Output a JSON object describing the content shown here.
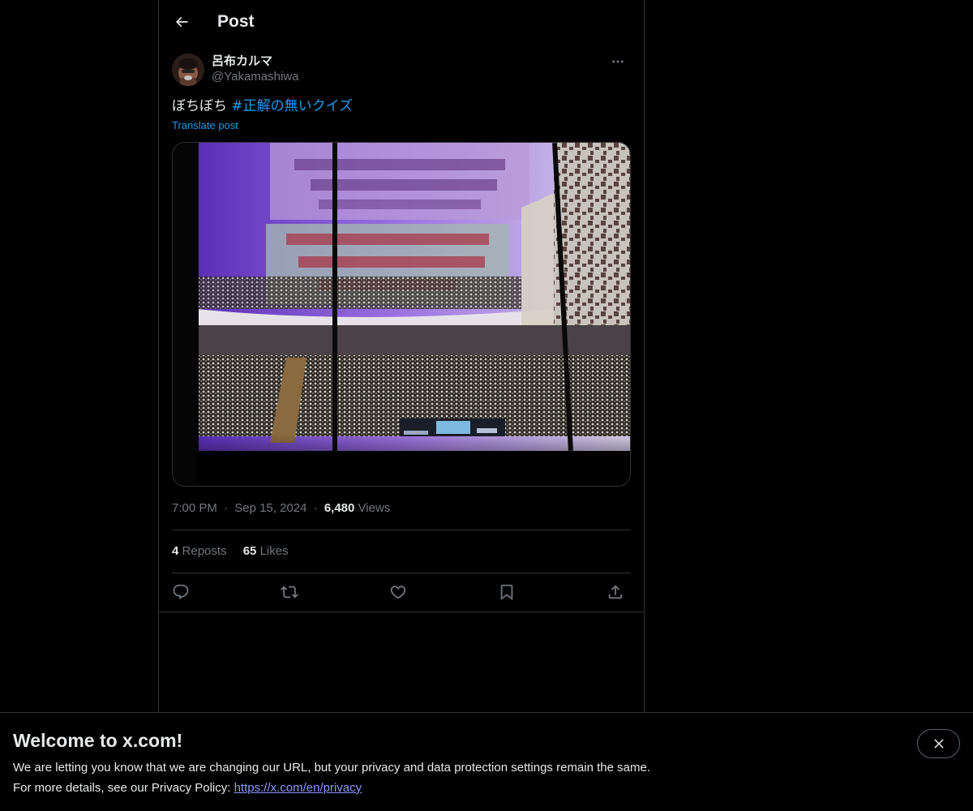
{
  "header": {
    "title": "Post",
    "back_icon": "arrow-left-icon"
  },
  "post": {
    "author": {
      "display_name": "呂布カルマ",
      "handle": "@Yakamashiwa"
    },
    "text_plain": "ぼちぼち ",
    "hashtag": "#正解の無いクイズ",
    "translate_label": "Translate post",
    "time": "7:00 PM",
    "date": "Sep 15, 2024",
    "separator": "·",
    "views_count": "6,480",
    "views_label": "Views",
    "reposts_count": "4",
    "reposts_label": "Reposts",
    "likes_count": "65",
    "likes_label": "Likes",
    "actions": [
      "reply-icon",
      "repost-icon",
      "like-icon",
      "bookmark-icon",
      "share-icon"
    ]
  },
  "banner": {
    "title": "Welcome to x.com!",
    "line1": "We are letting you know that we are changing our URL, but your privacy and data protection settings remain the same.",
    "line2_prefix": "For more details, see our Privacy Policy: ",
    "link": "https://x.com/en/privacy",
    "close_icon": "close-icon"
  },
  "colors": {
    "background": "#000000",
    "text": "#e7e9ea",
    "muted": "#71767b",
    "accent": "#1d9bf0",
    "border": "#2f3336",
    "link": "#8b98f9"
  }
}
